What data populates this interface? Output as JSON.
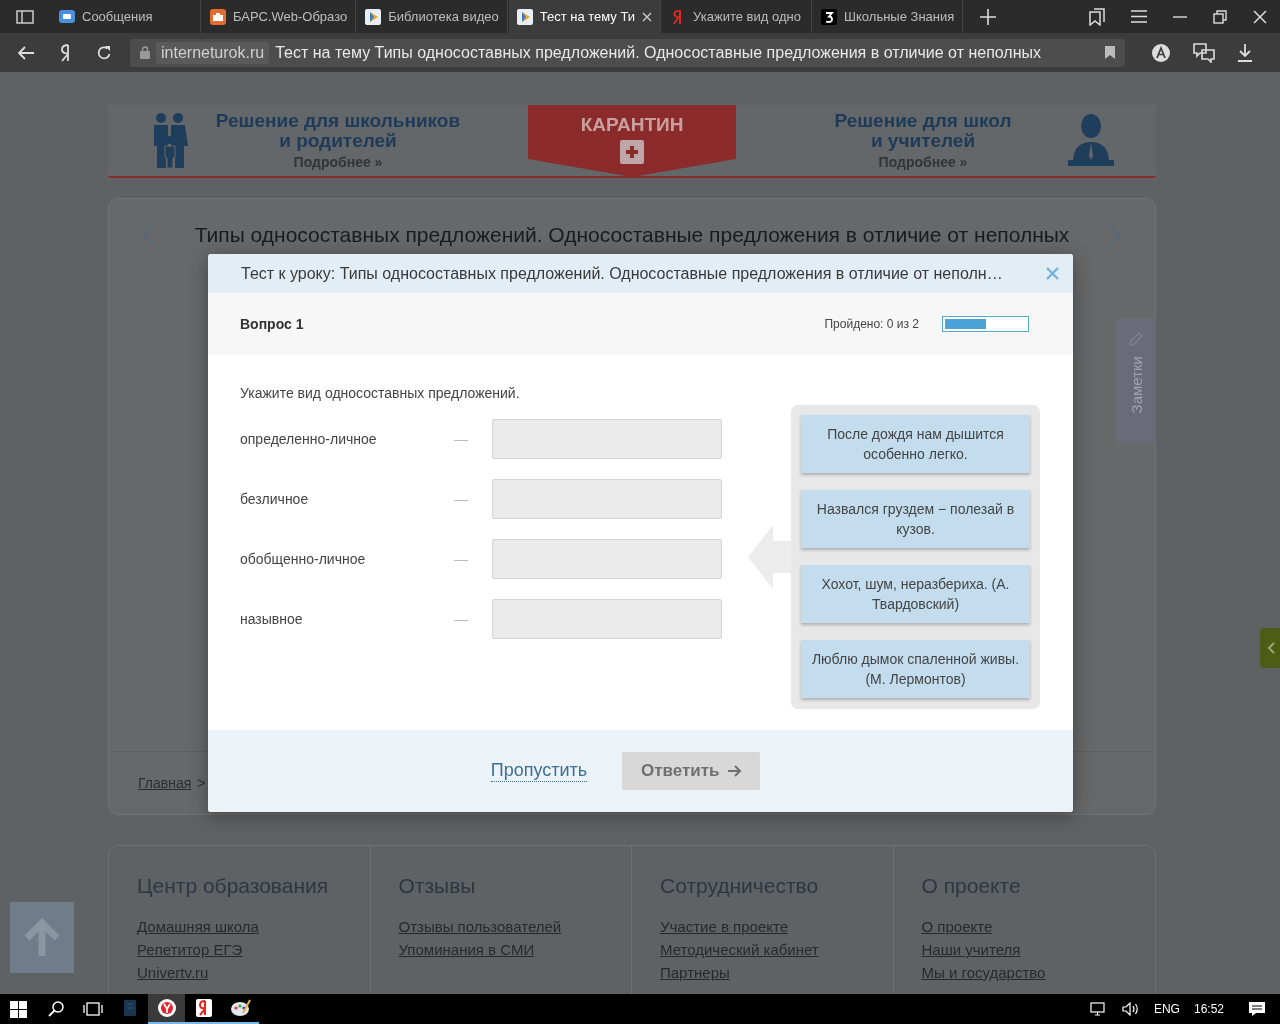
{
  "browser": {
    "tabs": [
      {
        "title": "Сообщения",
        "kind": "chat",
        "selected": false
      },
      {
        "title": "БАРС.Web-Образо",
        "kind": "bars",
        "selected": false
      },
      {
        "title": "Библиотека видео",
        "kind": "video",
        "selected": false
      },
      {
        "title": "Тест на тему Ти",
        "kind": "video",
        "selected": true
      },
      {
        "title": "Укажите вид одно",
        "kind": "yandex",
        "selected": false
      },
      {
        "title": "Школьные Знания",
        "kind": "znania",
        "selected": false
      }
    ],
    "address_bar": {
      "domain": "interneturok.ru",
      "page_title": "Тест на тему Типы односоставных предложений. Односоставные предложения в отличие от неполных"
    }
  },
  "page": {
    "banner": {
      "left": {
        "title_lines": [
          "Решение для школьников",
          "и родителей"
        ],
        "link": "Подробнее »"
      },
      "center": {
        "title": "КАРАНТИН"
      },
      "right": {
        "title_lines": [
          "Решение для школ",
          "и учителей"
        ],
        "link": "Подробнее »"
      }
    },
    "lesson": {
      "title": "Типы односоставных предложений. Односоставные предложения в отличие от неполных",
      "breadcrumb": [
        "Главная"
      ],
      "separator": ">"
    },
    "notes_tab": {
      "label": "Заметки"
    },
    "footer": {
      "columns": [
        {
          "heading": "Центр образования",
          "links": [
            "Домашняя школа",
            "Репетитор ЕГЭ",
            "Univertv.ru"
          ]
        },
        {
          "heading": "Отзывы",
          "links": [
            "Отзывы пользователей",
            "Упоминания в СМИ"
          ]
        },
        {
          "heading": "Сотрудничество",
          "links": [
            "Участие в проекте",
            "Методический кабинет",
            "Партнеры"
          ]
        },
        {
          "heading": "О проекте",
          "links": [
            "О проекте",
            "Наши учителя",
            "Мы и государство"
          ]
        }
      ]
    }
  },
  "modal": {
    "title": "Тест к уроку: Типы односоставных предложений. Односоставные предложения в отличие от неполн…",
    "question": "Вопрос 1",
    "progress": {
      "label": "Пройдено: 0 из 2",
      "level": 0.5
    },
    "instruction": "Укажите вид односоставных предложений.",
    "targets": [
      {
        "label": "определенно-личное",
        "dash": "—"
      },
      {
        "label": "безличное",
        "dash": "—"
      },
      {
        "label": "обобщенно-личное",
        "dash": "—"
      },
      {
        "label": "назывное",
        "dash": "—"
      }
    ],
    "options": [
      "После дождя нам дышится особенно легко.",
      "Назвался груздем − полезай в кузов.",
      "Хохот, шум, неразбериха. (А. Твардовский)",
      "Люблю дымок спаленной живы. (М. Лермонтов)"
    ],
    "skip": "Пропустить",
    "submit": {
      "label": "Ответить",
      "disabled": true
    }
  },
  "taskbar": {
    "apps": [
      {
        "kind": "notepad",
        "selected": false
      },
      {
        "kind": "yabrowser",
        "selected": true
      },
      {
        "kind": "yandex",
        "selected": false
      },
      {
        "kind": "paint",
        "selected": false
      }
    ],
    "language": "ENG",
    "time": "16:52"
  }
}
